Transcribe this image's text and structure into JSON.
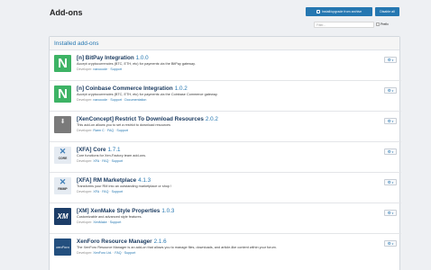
{
  "page": {
    "title": "Add-ons"
  },
  "toolbar": {
    "install_label": "Install/upgrade from archive",
    "disable_label": "Disable all"
  },
  "filter": {
    "placeholder": "Filter...",
    "prefix_label": "Prefix"
  },
  "panel": {
    "title": "Installed add-ons"
  },
  "addons": [
    {
      "name": "[n] BitPay Integration",
      "version": "1.0.0",
      "description": "Accept cryptocurrencies (BTC, ETH, etc) for payments via the BitPay gateway.",
      "developer_prefix": "Developer:",
      "developer": "nanocode",
      "sep": "·",
      "links": [
        "Support"
      ],
      "logo": "N"
    },
    {
      "name": "[n] Coinbase Commerce Integration",
      "version": "1.0.2",
      "description": "Accept cryptocurrencies (BTC, ETH, etc) for payments via the Coinbase Commerce gateway.",
      "developer_prefix": "Developer:",
      "developer": "nanocode",
      "sep": "·",
      "links": [
        "Support",
        "Documentation"
      ],
      "logo": "N"
    },
    {
      "name": "[XenConcept] Restrict To Download Resources",
      "version": "2.0.2",
      "description": "This add-on allows you to set a restrict to download resources",
      "developer_prefix": "Developer:",
      "developer": "Rarm C",
      "sep": "·",
      "links": [
        "FAQ",
        "Support"
      ],
      "logo": "download-icon"
    },
    {
      "name": "[XFA] Core",
      "version": "1.7.1",
      "description": "Core functions for Xen-Factory team add-ons.",
      "developer_prefix": "Developer:",
      "developer": "XFA",
      "sep": "·",
      "links": [
        "FAQ",
        "Support"
      ],
      "logo": "CORE"
    },
    {
      "name": "[XFA] RM Marketplace",
      "version": "4.1.3",
      "description": "Transforms your RM into an outstanding marketplace or shop !",
      "developer_prefix": "Developer:",
      "developer": "XFA",
      "sep": "·",
      "links": [
        "FAQ",
        "Support"
      ],
      "logo": "RMMP"
    },
    {
      "name": "[XM] XenMake Style Properties",
      "version": "1.0.3",
      "description": "Customizable and advanced style features.",
      "developer_prefix": "Developer:",
      "developer": "XenMake",
      "sep": "·",
      "links": [
        "Support"
      ],
      "logo": "XM"
    },
    {
      "name": "XenForo Resource Manager",
      "version": "2.1.6",
      "description": "The XenForo Resource Manager is an add-on that allows you to manage files, downloads, and article-like content within your forum.",
      "developer_prefix": "Developer:",
      "developer": "XenForo Ltd.",
      "sep": "·",
      "links": [
        "FAQ",
        "Support"
      ],
      "logo": "xenForo"
    }
  ],
  "colors": {
    "accent": "#2577b1",
    "title": "#1c3c61",
    "green": "#3db365"
  }
}
